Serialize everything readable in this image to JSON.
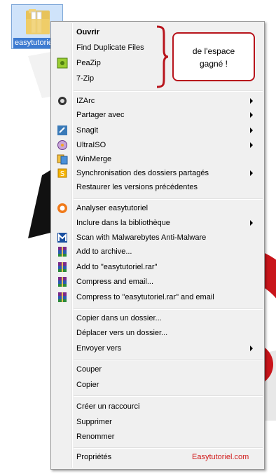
{
  "desktop": {
    "icon_name": "easytutoriel"
  },
  "callout": {
    "line1": "de l'espace",
    "line2": "gagné !"
  },
  "menu": {
    "items": [
      {
        "label": "Ouvrir",
        "bold": true,
        "icon": "none",
        "submenu": false
      },
      {
        "label": "Find Duplicate Files",
        "icon": "none",
        "submenu": false
      },
      {
        "label": "PeaZip",
        "icon": "peazip-icon",
        "submenu": false
      },
      {
        "label": "7-Zip",
        "icon": "none",
        "submenu": false
      },
      {
        "label": "IZArc",
        "icon": "izarc-icon",
        "submenu": true
      },
      {
        "label": "Partager avec",
        "icon": "none",
        "submenu": true
      },
      {
        "label": "Snagit",
        "icon": "snagit-icon",
        "submenu": true
      },
      {
        "label": "UltraISO",
        "icon": "ultraiso-icon",
        "submenu": true
      },
      {
        "label": "WinMerge",
        "icon": "winmerge-icon",
        "submenu": false
      },
      {
        "label": "Synchronisation des dossiers partagés",
        "icon": "sync-icon",
        "submenu": true
      },
      {
        "label": "Restaurer les versions précédentes",
        "icon": "none",
        "submenu": false
      },
      {
        "label": "Analyser easytutoriel",
        "icon": "avast-icon",
        "submenu": false
      },
      {
        "label": "Inclure dans la bibliothèque",
        "icon": "none",
        "submenu": true
      },
      {
        "label": "Scan with Malwarebytes Anti-Malware",
        "icon": "malwarebytes-icon",
        "submenu": false
      },
      {
        "label": "Add to archive...",
        "icon": "winrar-icon",
        "submenu": false
      },
      {
        "label": "Add to \"easytutoriel.rar\"",
        "icon": "winrar-icon",
        "submenu": false
      },
      {
        "label": "Compress and email...",
        "icon": "winrar-icon",
        "submenu": false
      },
      {
        "label": "Compress to \"easytutoriel.rar\" and email",
        "icon": "winrar-icon",
        "submenu": false
      },
      {
        "label": "Copier dans un dossier...",
        "icon": "none",
        "submenu": false
      },
      {
        "label": "Déplacer vers un dossier...",
        "icon": "none",
        "submenu": false
      },
      {
        "label": "Envoyer vers",
        "icon": "none",
        "submenu": true
      },
      {
        "label": "Couper",
        "icon": "none",
        "submenu": false
      },
      {
        "label": "Copier",
        "icon": "none",
        "submenu": false
      },
      {
        "label": "Créer un raccourci",
        "icon": "none",
        "submenu": false
      },
      {
        "label": "Supprimer",
        "icon": "none",
        "submenu": false
      },
      {
        "label": "Renommer",
        "icon": "none",
        "submenu": false
      },
      {
        "label": "Propriétés",
        "icon": "none",
        "submenu": false
      }
    ]
  },
  "watermark": "Easytutoriel.com",
  "colors": {
    "accent_red": "#b8141c",
    "menu_bg": "#f0f0f0",
    "selection_blue": "#3d7bd1"
  }
}
